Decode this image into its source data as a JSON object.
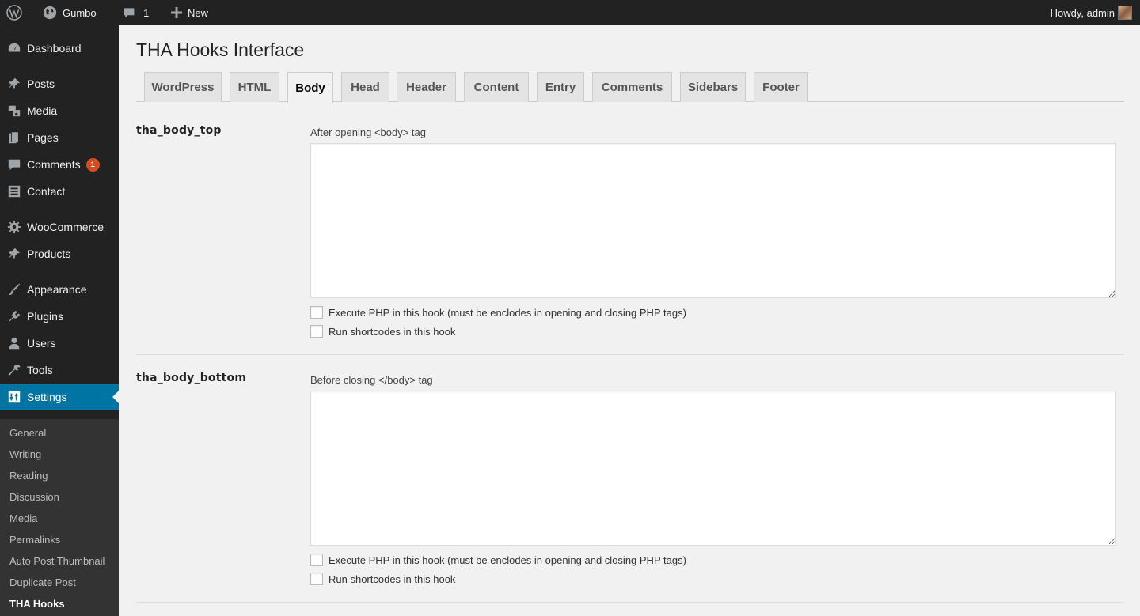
{
  "adminbar": {
    "site_name": "Gumbo",
    "comment_count": "1",
    "new_label": "New",
    "howdy": "Howdy, admin"
  },
  "sidebar": {
    "items": [
      {
        "label": "Dashboard",
        "icon": "dashboard-icon"
      },
      {
        "label": "Posts",
        "icon": "pin-icon"
      },
      {
        "label": "Media",
        "icon": "media-icon"
      },
      {
        "label": "Pages",
        "icon": "pages-icon"
      },
      {
        "label": "Comments",
        "icon": "comment-icon",
        "badge": "1"
      },
      {
        "label": "Contact",
        "icon": "contact-icon"
      },
      {
        "label": "WooCommerce",
        "icon": "gear-icon"
      },
      {
        "label": "Products",
        "icon": "pin-icon"
      },
      {
        "label": "Appearance",
        "icon": "brush-icon"
      },
      {
        "label": "Plugins",
        "icon": "plugin-icon"
      },
      {
        "label": "Users",
        "icon": "user-icon"
      },
      {
        "label": "Tools",
        "icon": "wrench-icon"
      },
      {
        "label": "Settings",
        "icon": "settings-icon",
        "current": true
      }
    ],
    "submenu": [
      "General",
      "Writing",
      "Reading",
      "Discussion",
      "Media",
      "Permalinks",
      "Auto Post Thumbnail",
      "Duplicate Post",
      "THA Hooks"
    ]
  },
  "page": {
    "title": "THA Hooks Interface",
    "tabs": [
      "WordPress",
      "HTML",
      "Body",
      "Head",
      "Header",
      "Content",
      "Entry",
      "Comments",
      "Sidebars",
      "Footer"
    ],
    "active_tab": "Body"
  },
  "hooks": [
    {
      "name": "tha_body_top",
      "description": "After opening <body> tag",
      "textarea_value": "",
      "php_label": "Execute PHP in this hook (must be enclodes in opening and closing PHP tags)",
      "shortcode_label": "Run shortcodes in this hook"
    },
    {
      "name": "tha_body_bottom",
      "description": "Before closing </body> tag",
      "textarea_value": "",
      "php_label": "Execute PHP in this hook (must be enclodes in opening and closing PHP tags)",
      "shortcode_label": "Run shortcodes in this hook"
    }
  ],
  "colors": {
    "adminbar_bg": "#222222",
    "sidebar_bg": "#222222",
    "submenu_bg": "#333333",
    "current_bg": "#0074a2",
    "badge_bg": "#d54e21",
    "content_bg": "#f1f1f1"
  }
}
